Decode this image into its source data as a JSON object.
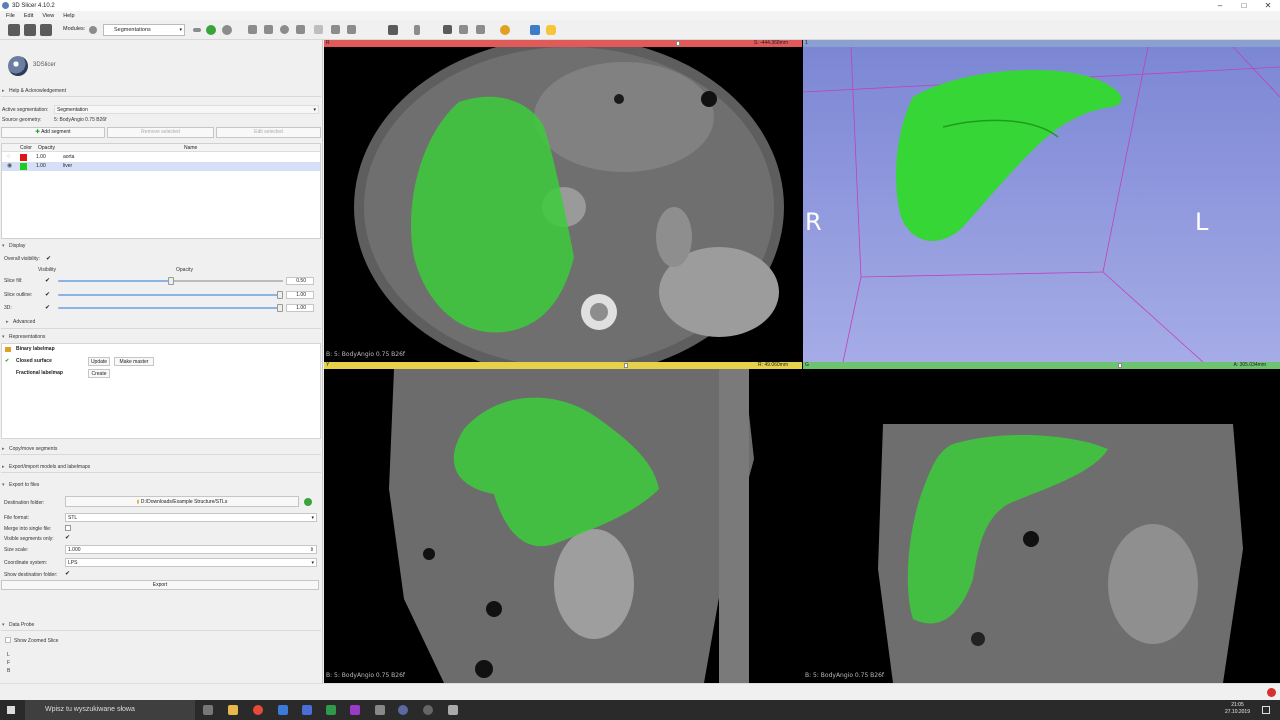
{
  "window": {
    "title": "3D Slicer 4.10.2"
  },
  "menu": [
    "File",
    "Edit",
    "View",
    "Help"
  ],
  "toolbar": {
    "modules_label": "Modules:",
    "module_selected": "Segmentations"
  },
  "logo": {
    "text": "3DSlicer"
  },
  "sections": {
    "help": "Help & Acknowledgement",
    "display": "Display",
    "advanced": "Advanced",
    "representations": "Representations",
    "copy_move": "Copy/move segments",
    "export_import": "Export/import models and labelmaps",
    "export_files": "Export to files",
    "data_probe": "Data Probe"
  },
  "segmentation": {
    "active_label": "Active segmentation:",
    "active_value": "Segmentation",
    "source_label": "Source geometry:",
    "source_value": "5: BodyAngio  0.75  B26f",
    "add_segment": "Add segment",
    "remove_selected": "Remove selected",
    "edit_selected": "Edit selected"
  },
  "segment_table": {
    "headers": [
      "Color",
      "Opacity",
      "Name"
    ],
    "rows": [
      {
        "color": "#e01414",
        "opacity": "1.00",
        "name": "aorta",
        "selected": false
      },
      {
        "color": "#1ecb1e",
        "opacity": "1.00",
        "name": "liver",
        "selected": true
      }
    ]
  },
  "display": {
    "overall_visibility": "Overall visibility:",
    "col_visibility": "Visibility",
    "col_opacity": "Opacity",
    "rows": [
      {
        "label": "Slice fill:",
        "value": "0.50",
        "fraction": 0.5
      },
      {
        "label": "Slice outline:",
        "value": "1.00",
        "fraction": 1.0
      },
      {
        "label": "3D:",
        "value": "1.00",
        "fraction": 1.0
      }
    ]
  },
  "representations": {
    "rows": [
      {
        "name": "Binary labelmap",
        "status": "master",
        "buttons": []
      },
      {
        "name": "Closed surface",
        "status": "present",
        "buttons": [
          "Update",
          "Make master"
        ]
      },
      {
        "name": "Fractional labelmap",
        "status": "none",
        "buttons": [
          "Create"
        ]
      }
    ]
  },
  "export": {
    "destination_label": "Destination folder:",
    "destination_value": "D:/Downloads/Example Structure/STLs",
    "format_label": "File format:",
    "format_value": "STL",
    "merge_label": "Merge into single file:",
    "visible_only_label": "Visible segments only:",
    "size_scale_label": "Size scale:",
    "size_scale_value": "1.000",
    "coord_label": "Coordinate system:",
    "coord_value": "LPS",
    "show_dest_label": "Show destination folder:",
    "export_button": "Export"
  },
  "probe": {
    "show_zoomed": "Show Zoomed Slice",
    "letters": [
      "L",
      "F",
      "B"
    ]
  },
  "views": {
    "red": {
      "pin": "R",
      "coord": "S: -444.368mm",
      "label": "B: 5: BodyAngio  0.75  B26f",
      "bar_color": "#e05a5a"
    },
    "three_d": {
      "pin": "1",
      "left": "R",
      "right": "L",
      "bar_color": "#8aa0d0"
    },
    "yellow": {
      "pin": "Y",
      "coord": "R: 49.060mm",
      "label": "B: 5: BodyAngio  0.75  B26f",
      "bar_color": "#e6d24a"
    },
    "green": {
      "pin": "G",
      "coord": "A: 305.034mm",
      "label": "B: 5: BodyAngio  0.75  B26f",
      "bar_color": "#6ec46e"
    }
  },
  "taskbar": {
    "search_placeholder": "Wpisz tu wyszukiwane słowa",
    "time": "21:05",
    "date": "27.10.2019"
  }
}
